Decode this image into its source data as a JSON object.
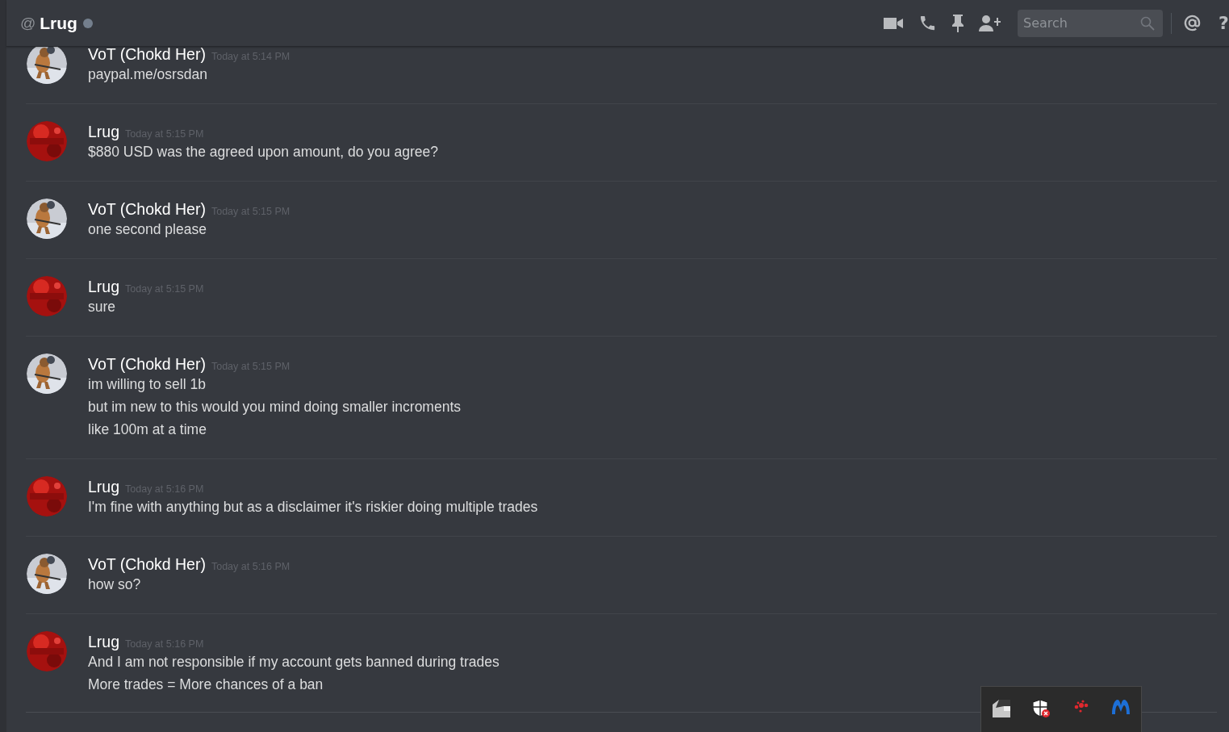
{
  "header": {
    "prefix": "@",
    "title": "Lrug",
    "online": false,
    "search": {
      "placeholder": "Search"
    },
    "help": "?"
  },
  "messages": [
    {
      "author": "VoT (Chokd Her)",
      "timestamp": "Today at 5:14 PM",
      "lines": [
        "paypal.me/osrsdan"
      ]
    },
    {
      "author": "Lrug",
      "timestamp": "Today at 5:15 PM",
      "lines": [
        "$880 USD was the agreed upon amount, do you agree?"
      ]
    },
    {
      "author": "VoT (Chokd Her)",
      "timestamp": "Today at 5:15 PM",
      "lines": [
        "one second please"
      ]
    },
    {
      "author": "Lrug",
      "timestamp": "Today at 5:15 PM",
      "lines": [
        "sure"
      ]
    },
    {
      "author": "VoT (Chokd Her)",
      "timestamp": "Today at 5:15 PM",
      "lines": [
        "im willing to sell 1b",
        "but im new to this would you mind doing smaller incroments",
        "like 100m at a time"
      ]
    },
    {
      "author": "Lrug",
      "timestamp": "Today at 5:16 PM",
      "lines": [
        "I'm fine with anything but as a disclaimer it's riskier doing multiple trades"
      ]
    },
    {
      "author": "VoT (Chokd Her)",
      "timestamp": "Today at 5:16 PM",
      "lines": [
        "how so?"
      ]
    },
    {
      "author": "Lrug",
      "timestamp": "Today at 5:16 PM",
      "lines": [
        "And I am not responsible if my account gets banned during trades",
        "More trades = More chances of a ban"
      ]
    }
  ]
}
